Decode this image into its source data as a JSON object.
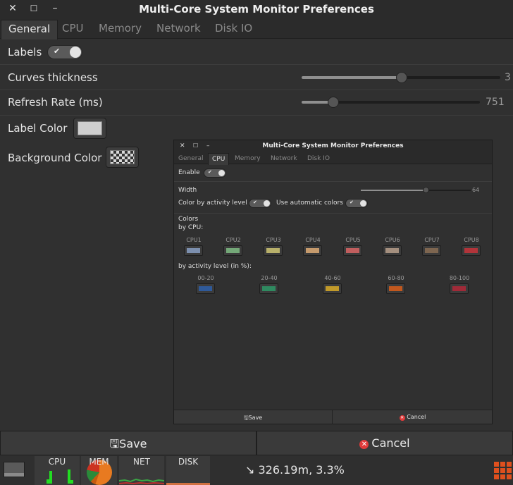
{
  "window": {
    "title": "Multi-Core System Monitor Preferences",
    "close_glyph": "✕",
    "maximize_glyph": "☐",
    "minimize_glyph": "–"
  },
  "tabs": [
    "General",
    "CPU",
    "Memory",
    "Network",
    "Disk IO"
  ],
  "general": {
    "labels": {
      "label": "Labels",
      "enabled": true
    },
    "curves_thickness": {
      "label": "Curves thickness",
      "value": "3",
      "fraction": 0.5
    },
    "refresh_rate": {
      "label": "Refresh Rate (ms)",
      "value": "751",
      "fraction": 0.16
    },
    "label_color": {
      "label": "Label Color",
      "color": "#cfcfcf"
    },
    "background_color": {
      "label": "Background Color"
    }
  },
  "inner": {
    "title": "Multi-Core System Monitor Preferences",
    "tabs": [
      "General",
      "CPU",
      "Memory",
      "Network",
      "Disk IO"
    ],
    "enable_label": "Enable",
    "width_label": "Width",
    "width_value": "64",
    "color_by_activity_label": "Color by activity level",
    "use_auto_colors_label": "Use automatic colors",
    "colors_label": "Colors",
    "by_cpu_label": "by CPU:",
    "cpus": [
      {
        "label": "CPU1",
        "color": "#7c8fae"
      },
      {
        "label": "CPU2",
        "color": "#74a878"
      },
      {
        "label": "CPU3",
        "color": "#b8b06a"
      },
      {
        "label": "CPU4",
        "color": "#c59a6c"
      },
      {
        "label": "CPU5",
        "color": "#c15e5e"
      },
      {
        "label": "CPU6",
        "color": "#a48f7e"
      },
      {
        "label": "CPU7",
        "color": "#7e6650"
      },
      {
        "label": "CPU8",
        "color": "#b2343a"
      }
    ],
    "by_activity_label": "by activity level (in %):",
    "levels": [
      {
        "label": "00-20",
        "color": "#2f5a9a"
      },
      {
        "label": "20-40",
        "color": "#2f8a60"
      },
      {
        "label": "40-60",
        "color": "#c19a2a"
      },
      {
        "label": "60-80",
        "color": "#c2581e"
      },
      {
        "label": "80-100",
        "color": "#a02a38"
      }
    ],
    "save_label": "Save",
    "cancel_label": "Cancel"
  },
  "buttons": {
    "save": "Save",
    "cancel": "Cancel"
  },
  "panel": {
    "cpu_label": "CPU",
    "mem_label": "MEM",
    "net_label": "NET",
    "disk_label": "DISK",
    "readout": "↘ 326.19m, 3.3%"
  }
}
